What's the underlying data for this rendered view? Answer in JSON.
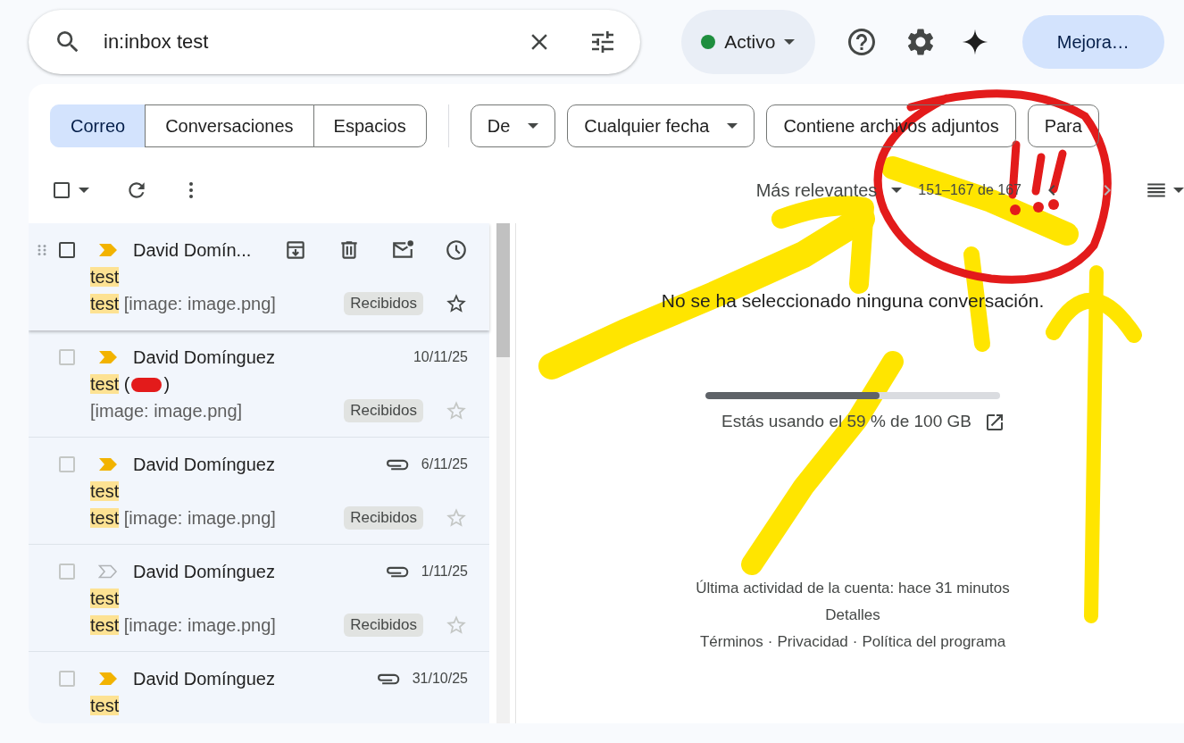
{
  "search": {
    "value": "in:inbox test"
  },
  "status": {
    "label": "Activo"
  },
  "upgrade_button": "Mejora…",
  "tabs": [
    {
      "label": "Correo",
      "selected": true
    },
    {
      "label": "Conversaciones",
      "selected": false
    },
    {
      "label": "Espacios",
      "selected": false
    }
  ],
  "filters": [
    {
      "label": "De",
      "dropdown": true
    },
    {
      "label": "Cualquier fecha",
      "dropdown": true
    },
    {
      "label": "Contiene archivos adjuntos",
      "dropdown": false
    },
    {
      "label": "Para",
      "dropdown": false
    }
  ],
  "toolbar": {
    "select_all": {
      "checked": false
    },
    "sort": "Más relevantes",
    "range": "151–167 de 167"
  },
  "messages": [
    {
      "sender": "David Domín...",
      "hovered": true,
      "selected": false,
      "important": true,
      "starred": false,
      "subject": {
        "highlight": "test"
      },
      "snippet": {
        "highlight": "test",
        "rest": " [image: image.png]"
      },
      "label": "Recibidos"
    },
    {
      "sender": "David Domínguez",
      "date": "10/11/25",
      "hovered": false,
      "selected": false,
      "important": true,
      "attachment": false,
      "starred": false,
      "subject": {
        "highlight": "test",
        "rest": " (",
        "redacted": true,
        "after": ")"
      },
      "snippet": {
        "rest": "[image: image.png]"
      },
      "label": "Recibidos"
    },
    {
      "sender": "David Domínguez",
      "date": "6/11/25",
      "hovered": false,
      "selected": false,
      "important": true,
      "attachment": true,
      "starred": false,
      "subject": {
        "highlight": "test"
      },
      "snippet": {
        "highlight": "test",
        "rest": " [image: image.png]"
      },
      "label": "Recibidos"
    },
    {
      "sender": "David Domínguez",
      "date": "1/11/25",
      "hovered": false,
      "selected": false,
      "important": false,
      "attachment": true,
      "starred": false,
      "subject": {
        "highlight": "test"
      },
      "snippet": {
        "highlight": "test",
        "rest": " [image: image.png]"
      },
      "label": "Recibidos"
    },
    {
      "sender": "David Domínguez",
      "date": "31/10/25",
      "hovered": false,
      "selected": false,
      "important": true,
      "attachment": true,
      "subject": {
        "highlight": "test"
      }
    }
  ],
  "reading_pane": {
    "empty_message": "No se ha seleccionado ninguna conversación.",
    "storage": {
      "level": 0.59,
      "text": "Estás usando el 59 % de 100 GB"
    },
    "last_activity": "Última actividad de la cuenta: hace 31 minutos",
    "details_link": "Detalles",
    "footer_links": [
      "Términos",
      "Privacidad",
      "Política del programa"
    ],
    "footer_separator": "·"
  }
}
